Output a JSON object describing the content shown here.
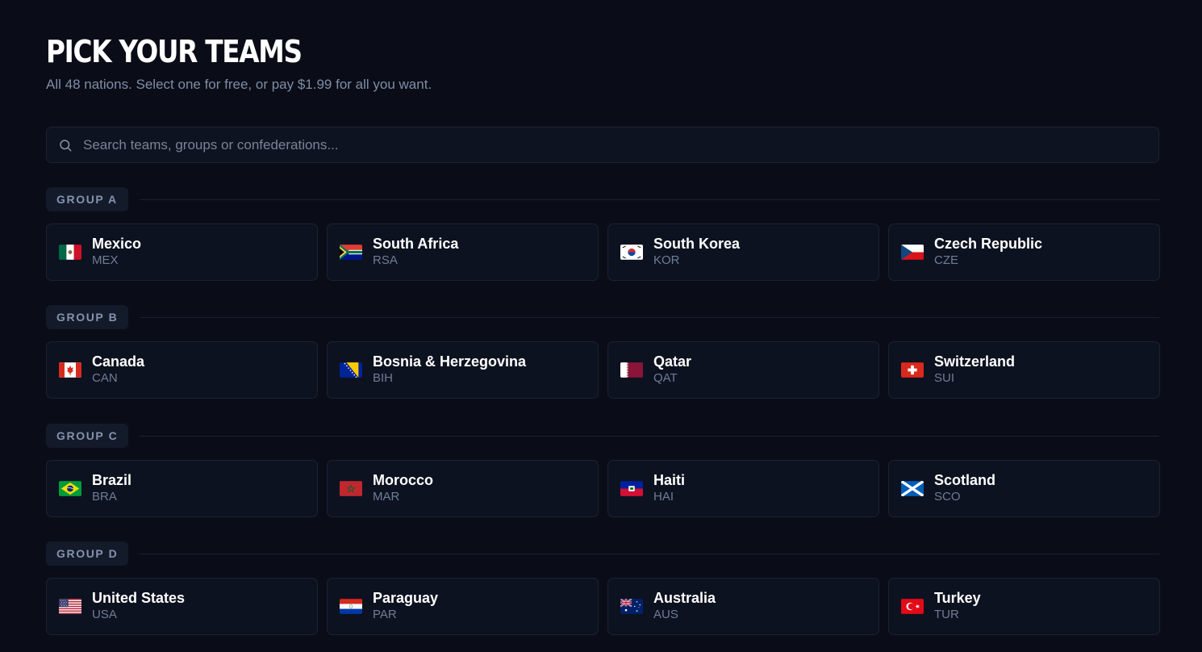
{
  "header": {
    "title": "PICK YOUR TEAMS",
    "subtitle": "All 48 nations. Select one for free, or pay $1.99 for all you want."
  },
  "search": {
    "placeholder": "Search teams, groups or confederations...",
    "value": "",
    "icon": "search-icon"
  },
  "groups": [
    {
      "label": "GROUP A",
      "teams": [
        {
          "name": "Mexico",
          "code": "MEX",
          "flag": "flag-mexico-icon"
        },
        {
          "name": "South Africa",
          "code": "RSA",
          "flag": "flag-south-africa-icon"
        },
        {
          "name": "South Korea",
          "code": "KOR",
          "flag": "flag-south-korea-icon"
        },
        {
          "name": "Czech Republic",
          "code": "CZE",
          "flag": "flag-czech-republic-icon"
        }
      ]
    },
    {
      "label": "GROUP B",
      "teams": [
        {
          "name": "Canada",
          "code": "CAN",
          "flag": "flag-canada-icon"
        },
        {
          "name": "Bosnia & Herzegovina",
          "code": "BIH",
          "flag": "flag-bosnia-icon"
        },
        {
          "name": "Qatar",
          "code": "QAT",
          "flag": "flag-qatar-icon"
        },
        {
          "name": "Switzerland",
          "code": "SUI",
          "flag": "flag-switzerland-icon"
        }
      ]
    },
    {
      "label": "GROUP C",
      "teams": [
        {
          "name": "Brazil",
          "code": "BRA",
          "flag": "flag-brazil-icon"
        },
        {
          "name": "Morocco",
          "code": "MAR",
          "flag": "flag-morocco-icon"
        },
        {
          "name": "Haiti",
          "code": "HAI",
          "flag": "flag-haiti-icon"
        },
        {
          "name": "Scotland",
          "code": "SCO",
          "flag": "flag-scotland-icon"
        }
      ]
    },
    {
      "label": "GROUP D",
      "teams": [
        {
          "name": "United States",
          "code": "USA",
          "flag": "flag-united-states-icon"
        },
        {
          "name": "Paraguay",
          "code": "PAR",
          "flag": "flag-paraguay-icon"
        },
        {
          "name": "Australia",
          "code": "AUS",
          "flag": "flag-australia-icon"
        },
        {
          "name": "Turkey",
          "code": "TUR",
          "flag": "flag-turkey-icon"
        }
      ]
    }
  ],
  "colors": {
    "background": "#0a0d17",
    "card": "#0d1220",
    "border": "#1c2233",
    "muted_text": "#7e8da8"
  }
}
